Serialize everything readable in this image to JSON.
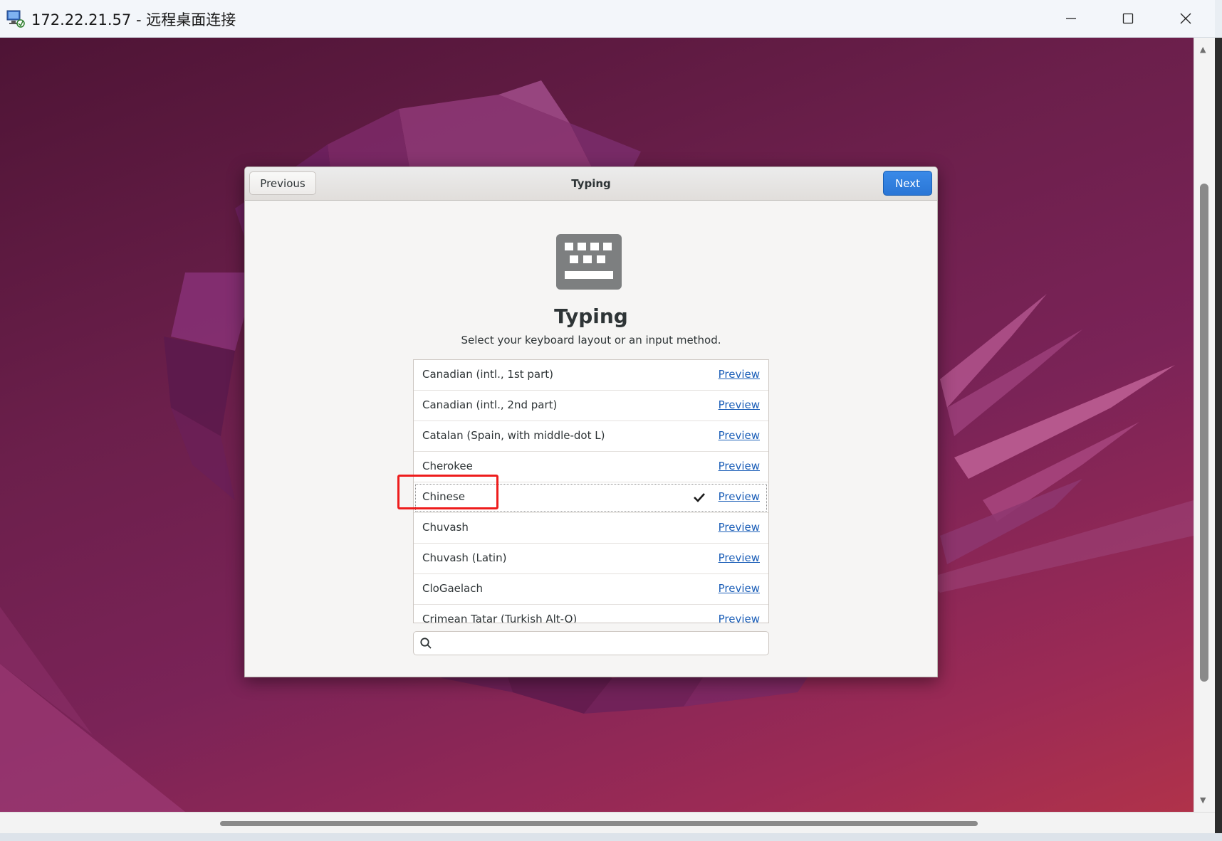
{
  "rdp_window": {
    "title": "172.22.21.57 - 远程桌面连接",
    "controls": [
      "minimize",
      "maximize",
      "close"
    ]
  },
  "dialog": {
    "header_title": "Typing",
    "previous_label": "Previous",
    "next_label": "Next",
    "heading": "Typing",
    "subtitle": "Select your keyboard layout or an input method.",
    "icon": "keyboard-icon",
    "layouts": [
      {
        "label": "Canadian (intl., 1st part)",
        "link": "Preview",
        "selected": false
      },
      {
        "label": "Canadian (intl., 2nd part)",
        "link": "Preview",
        "selected": false
      },
      {
        "label": "Catalan (Spain, with middle-dot L)",
        "link": "Preview",
        "selected": false
      },
      {
        "label": "Cherokee",
        "link": "Preview",
        "selected": false
      },
      {
        "label": "Chinese",
        "link": "Preview",
        "selected": true
      },
      {
        "label": "Chuvash",
        "link": "Preview",
        "selected": false
      },
      {
        "label": "Chuvash (Latin)",
        "link": "Preview",
        "selected": false
      },
      {
        "label": "CloGaelach",
        "link": "Preview",
        "selected": false
      },
      {
        "label": "Crimean Tatar (Turkish Alt-Q)",
        "link": "Preview",
        "selected": false
      }
    ],
    "search": {
      "value": "",
      "placeholder": ""
    }
  },
  "colors": {
    "accent": "#2a76d6",
    "link": "#1c5fb8",
    "annotation": "#ee1c1c",
    "wallpaper": "#7a2357"
  }
}
